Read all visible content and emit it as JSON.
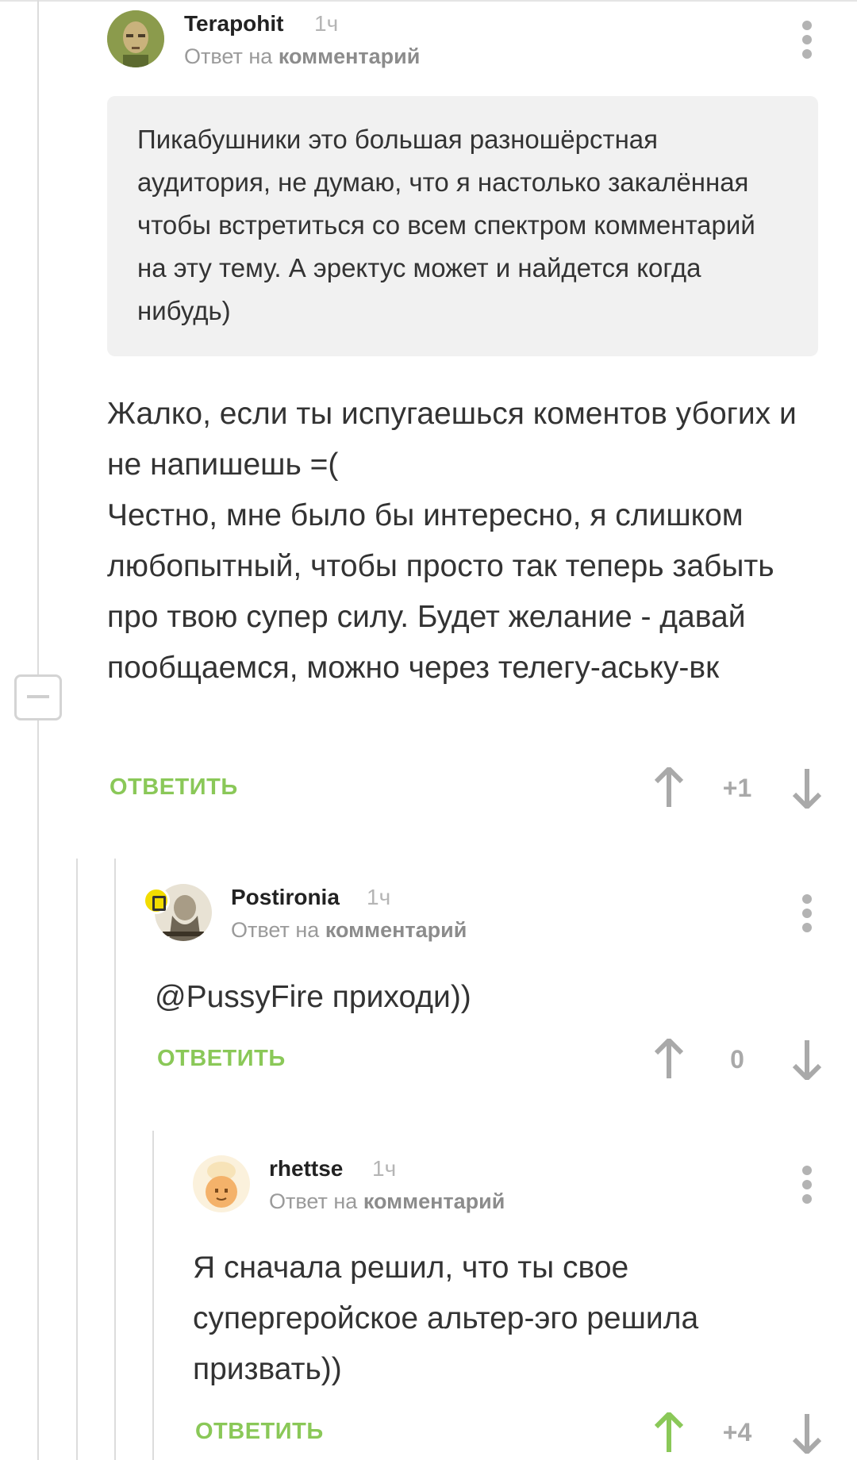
{
  "comments": [
    {
      "username": "Terapohit",
      "time": "1ч",
      "reply_prefix": "Ответ на",
      "reply_link": "комментарий",
      "quote": "Пикабушники это большая разношёрстная аудитория, не думаю, что я настолько закалённая чтобы встретиться со всем спектром комментарий на эту тему.  А эректус может и найдется когда нибудь)",
      "body": "Жалко, если ты испугаешься коментов убогих и не напишешь =(\nЧестно, мне было бы интересно, я слишком любопытный, чтобы просто так теперь забыть про твою супер силу. Будет желание - давай пообщаемся, можно через телегу-аську-вк",
      "reply_label": "ОТВЕТИТЬ",
      "rating": "+1"
    },
    {
      "username": "Postironia",
      "time": "1ч",
      "reply_prefix": "Ответ на",
      "reply_link": "комментарий",
      "body": "@PussyFire приходи))",
      "reply_label": "ОТВЕТИТЬ",
      "rating": "0"
    },
    {
      "username": "rhettse",
      "time": "1ч",
      "reply_prefix": "Ответ на",
      "reply_link": "комментарий",
      "body": "Я сначала решил, что ты свое супергеройское альтер-эго решила призвать))",
      "reply_label": "ОТВЕТИТЬ",
      "rating": "+4"
    }
  ],
  "colors": {
    "accent_green": "#8ac858",
    "upvoted_green": "#8ac858",
    "neutral_gray": "#a9a9a9",
    "badge_yellow": "#f2dc00"
  }
}
